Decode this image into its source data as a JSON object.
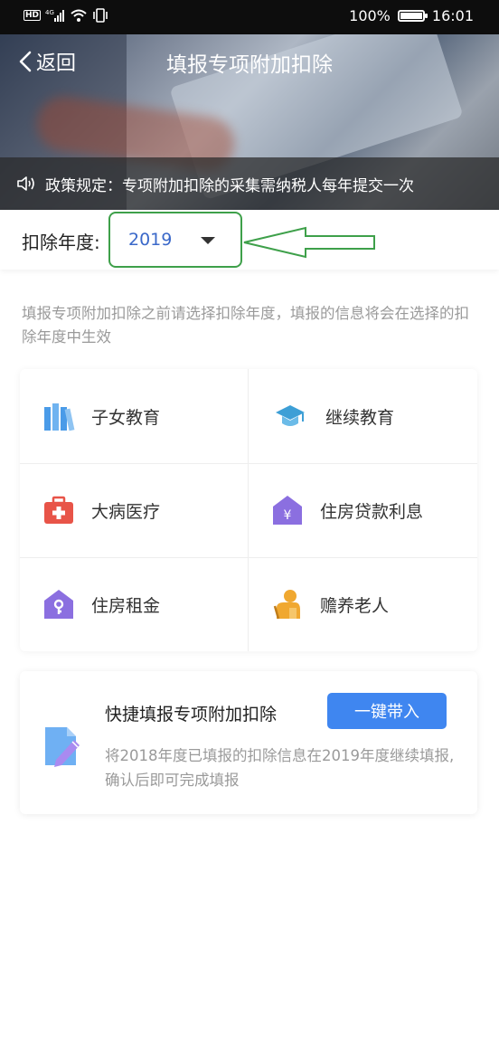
{
  "status_bar": {
    "left_icons": [
      "hd-icon",
      "4g-signal-icon",
      "wifi-icon",
      "vibrate-icon"
    ],
    "battery_percent": "100%",
    "time": "16:01"
  },
  "nav": {
    "back_label": "返回",
    "title": "填报专项附加扣除"
  },
  "notice": {
    "text": "政策规定：专项附加扣除的采集需纳税人每年提交一次"
  },
  "year": {
    "label": "扣除年度:",
    "selected": "2019"
  },
  "hint": "填报专项附加扣除之前请选择扣除年度，填报的信息将会在选择的扣除年度中生效",
  "categories": [
    {
      "label": "子女教育",
      "icon": "books-icon",
      "color": "#4a9be8"
    },
    {
      "label": "继续教育",
      "icon": "graduation-cap-icon",
      "color": "#3d9fd6"
    },
    {
      "label": "大病医疗",
      "icon": "medical-kit-icon",
      "color": "#e85448"
    },
    {
      "label": "住房贷款利息",
      "icon": "house-yuan-icon",
      "color": "#8b6fe0"
    },
    {
      "label": "住房租金",
      "icon": "house-key-icon",
      "color": "#8b6fe0"
    },
    {
      "label": "赡养老人",
      "icon": "elder-icon",
      "color": "#f0a830"
    }
  ],
  "quick": {
    "title": "快捷填报专项附加扣除",
    "button": "一键带入",
    "description": "将2018年度已填报的扣除信息在2019年度继续填报,确认后即可完成填报"
  },
  "colors": {
    "accent": "#3f86f0",
    "annotation": "#3ea04a",
    "year_text": "#3a68c9"
  }
}
